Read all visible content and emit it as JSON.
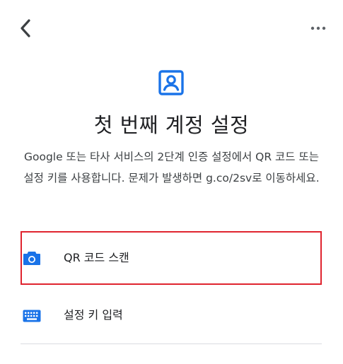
{
  "header": {
    "back_icon": "chevron-left-icon",
    "more_icon": "more-horizontal-icon"
  },
  "main": {
    "header_icon": "account-box-icon",
    "title": "첫 번째 계정 설정",
    "description": "Google 또는 타사 서비스의 2단계 인증 설정에서 QR 코드 또는 설정 키를 사용합니다. 문제가 발생하면 g.co/2sv로 이동하세요."
  },
  "options": [
    {
      "label": "QR 코드 스캔",
      "icon": "camera-icon"
    },
    {
      "label": "설정 키 입력",
      "icon": "keyboard-icon"
    }
  ],
  "colors": {
    "accent": "#1a73e8",
    "highlight_border": "#e0242f",
    "text_primary": "#202124",
    "text_secondary": "#3c4043",
    "divider": "#dadce0"
  }
}
